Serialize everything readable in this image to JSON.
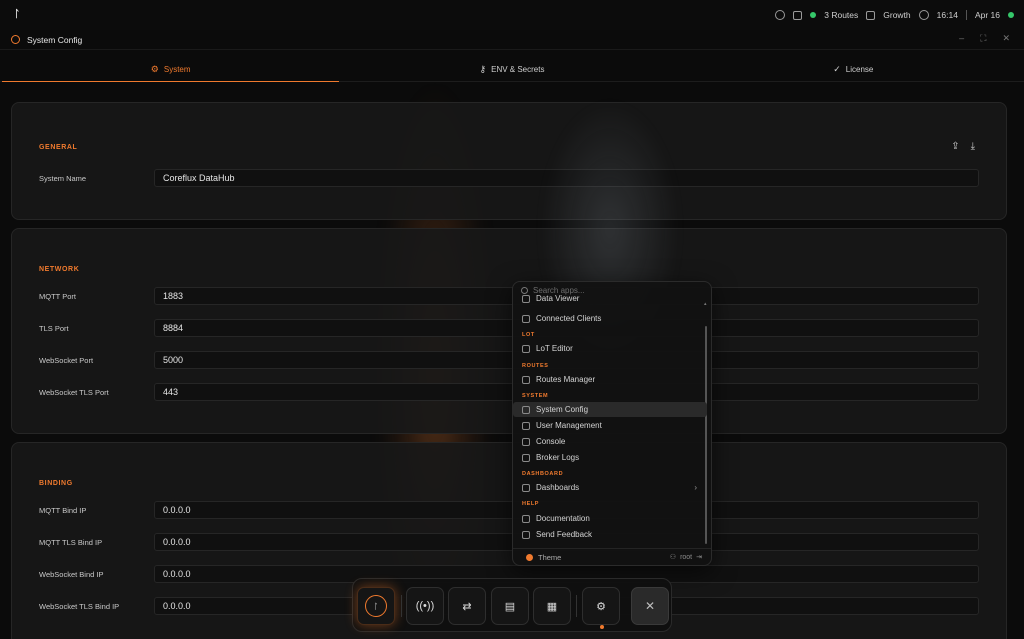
{
  "topbar": {
    "routes": "3 Routes",
    "plan": "Growth",
    "time": "16:14",
    "date": "Apr 16"
  },
  "window": {
    "title": "System Config"
  },
  "tabs": [
    {
      "label": "System",
      "icon": "gear-icon",
      "active": true
    },
    {
      "label": "ENV & Secrets",
      "icon": "key-icon",
      "active": false
    },
    {
      "label": "License",
      "icon": "check-circle-icon",
      "active": false
    }
  ],
  "general": {
    "title": "GENERAL",
    "fields": [
      {
        "label": "System Name",
        "value": "Coreflux DataHub"
      }
    ]
  },
  "network": {
    "title": "NETWORK",
    "fields": [
      {
        "label": "MQTT Port",
        "value": "1883"
      },
      {
        "label": "TLS Port",
        "value": "8884"
      },
      {
        "label": "WebSocket Port",
        "value": "5000"
      },
      {
        "label": "WebSocket TLS Port",
        "value": "443"
      }
    ]
  },
  "binding": {
    "title": "BINDING",
    "fields": [
      {
        "label": "MQTT Bind IP",
        "value": "0.0.0.0"
      },
      {
        "label": "MQTT TLS Bind IP",
        "value": "0.0.0.0"
      },
      {
        "label": "WebSocket Bind IP",
        "value": "0.0.0.0"
      },
      {
        "label": "WebSocket TLS Bind IP",
        "value": "0.0.0.0"
      }
    ]
  },
  "launcher": {
    "search_placeholder": "Search apps...",
    "groups": {
      "lot": "LOT",
      "routes": "ROUTES",
      "system": "SYSTEM",
      "dashboard": "DASHBOARD",
      "help": "HELP"
    },
    "items": {
      "data_viewer": "Data Viewer",
      "connected_clients": "Connected Clients",
      "lot_editor": "LoT Editor",
      "routes_manager": "Routes Manager",
      "system_config": "System Config",
      "user_management": "User Management",
      "console": "Console",
      "broker_logs": "Broker Logs",
      "dashboards": "Dashboards",
      "documentation": "Documentation",
      "send_feedback": "Send Feedback"
    },
    "footer": {
      "theme": "Theme",
      "user": "root"
    }
  },
  "colors": {
    "accent": "#f07a2e",
    "status_ok": "#35c86a"
  }
}
